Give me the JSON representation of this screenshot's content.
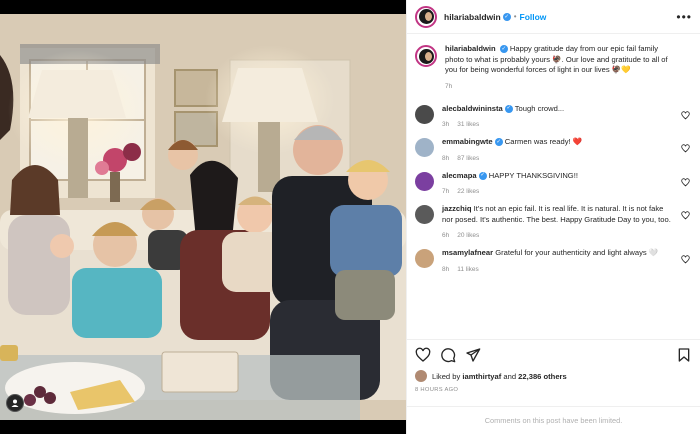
{
  "post": {
    "username": "hilariabaldwin",
    "follow_label": "Follow",
    "separator": "•",
    "more_label": "•••"
  },
  "caption": {
    "username": "hilariabaldwin",
    "text": "Happy gratitude day from our epic fail family photo to what is probably yours 🦃. Our love and gratitude to all of you for being wonderful forces of light in our lives 🦃💛",
    "age": "7h"
  },
  "comments": [
    {
      "username": "alecbaldwininsta",
      "verified": true,
      "text": "Tough crowd...",
      "age": "3h",
      "likes": "31 likes",
      "avatar_color": "#4a4a4a"
    },
    {
      "username": "emmabingwte",
      "verified": true,
      "text": "Carmen was ready! ❤️",
      "age": "8h",
      "likes": "87 likes",
      "avatar_color": "#9fb3c8"
    },
    {
      "username": "alecmapa",
      "verified": true,
      "text": "HAPPY THANKSGIVING!!",
      "age": "7h",
      "likes": "22 likes",
      "avatar_color": "#7b3fa0"
    },
    {
      "username": "jazzchiq",
      "verified": false,
      "text": "It's not an epic fail. It is real life. It is natural. It is not fake nor posed. It's authentic. The best. Happy Gratitude Day to you, too.",
      "age": "6h",
      "likes": "20 likes",
      "avatar_color": "#5a5a5a"
    },
    {
      "username": "msamylafnear",
      "verified": false,
      "text": "Grateful for your authenticity and light always 🤍",
      "age": "8h",
      "likes": "11 likes",
      "avatar_color": "#c9a27a"
    }
  ],
  "likes": {
    "prefix": "Liked by",
    "user": "iamthirtyaf",
    "joiner": "and",
    "others": "22,386 others"
  },
  "timestamp": "8 HOURS AGO",
  "comments_limited": "Comments on this post have been limited.",
  "colors": {
    "accent": "#0095f6",
    "verified": "#3897f0",
    "text": "#262626",
    "muted": "#8e8e8e",
    "story_ring": "#c13584"
  },
  "icons": [
    "heart-icon",
    "comment-icon",
    "share-icon",
    "bookmark-icon",
    "verified-icon",
    "more-icon",
    "user-tag-icon"
  ]
}
